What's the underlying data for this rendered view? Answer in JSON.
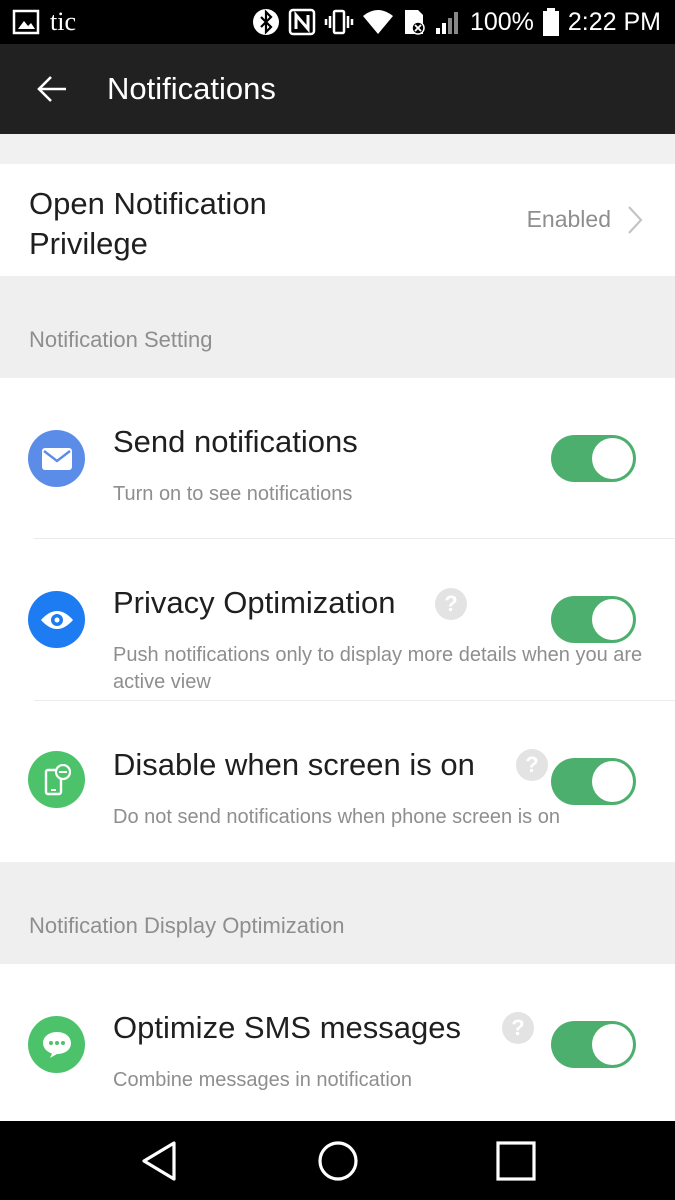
{
  "status_bar": {
    "app_label": "tic",
    "battery": "100%",
    "time": "2:22 PM"
  },
  "app_bar": {
    "title": "Notifications"
  },
  "privilege": {
    "label": "Open Notification Privilege",
    "value": "Enabled"
  },
  "sections": {
    "notification_setting": "Notification Setting",
    "display_optimization": "Notification Display Optimization"
  },
  "settings": [
    {
      "title": "Send notifications",
      "subtitle": "Turn on to see notifications",
      "icon": "envelope-icon",
      "icon_color": "#5b8de8",
      "help": false,
      "enabled": true
    },
    {
      "title": "Privacy Optimization",
      "subtitle": "Push notifications only to display more details when you are active view",
      "icon": "eye-icon",
      "icon_color": "#1e7cf2",
      "help": true,
      "enabled": true
    },
    {
      "title": "Disable when screen is on",
      "subtitle": "Do not send notifications when phone screen is on",
      "icon": "phone-screen-icon",
      "icon_color": "#4cc26b",
      "help": true,
      "enabled": true
    }
  ],
  "display_settings": [
    {
      "title": "Optimize SMS messages",
      "subtitle": "Combine messages in notification",
      "icon": "chat-bubble-icon",
      "icon_color": "#4cc26b",
      "help": true,
      "enabled": true
    }
  ],
  "help_glyph": "?",
  "colors": {
    "toggle_on": "#4caf6e",
    "app_bar": "#212121",
    "secondary_text": "#8e8e8e"
  }
}
